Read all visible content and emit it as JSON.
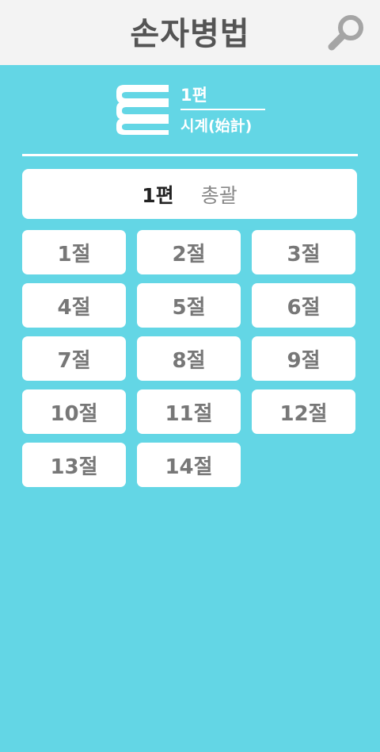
{
  "header": {
    "title": "손자병법",
    "search_icon": "search-icon"
  },
  "part": {
    "number": "1편",
    "name": "시계(始計)",
    "icon": "book-stack-icon"
  },
  "banner": {
    "number": "1편",
    "title": "총괄"
  },
  "sections": [
    "1절",
    "2절",
    "3절",
    "4절",
    "5절",
    "6절",
    "7절",
    "8절",
    "9절",
    "10절",
    "11절",
    "12절",
    "13절",
    "14절"
  ],
  "colors": {
    "background": "#63d6e5",
    "header": "#f3f3f3",
    "button": "#ffffff",
    "button_text": "#777777"
  }
}
